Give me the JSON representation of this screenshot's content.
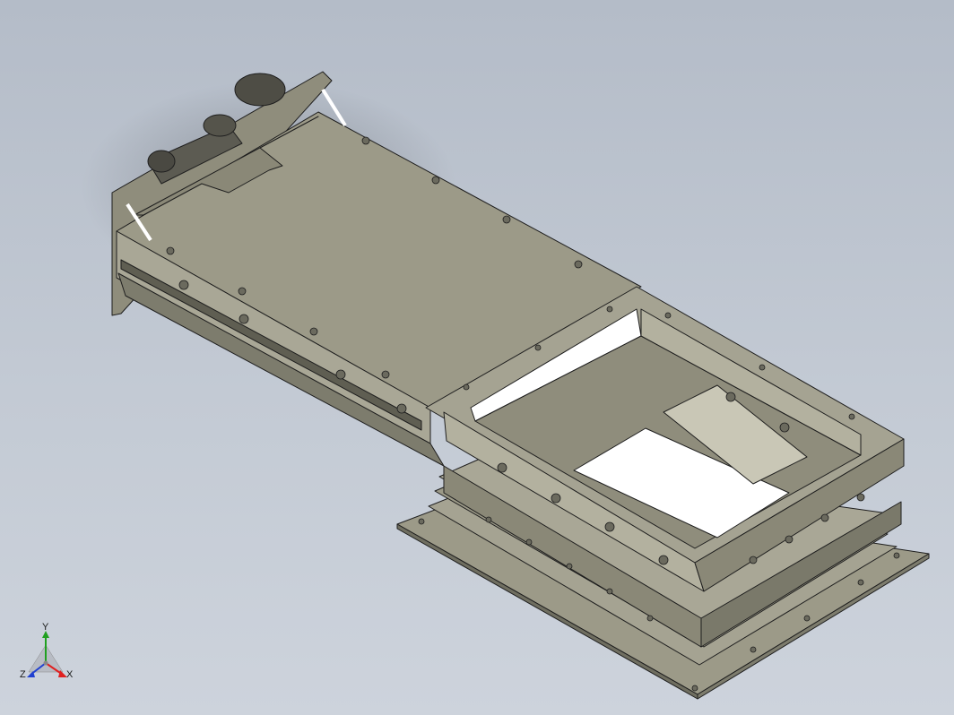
{
  "viewport": {
    "background_top": "#b4bcc8",
    "background_bottom": "#cdd3dc"
  },
  "model": {
    "body_color": "#9c9a88",
    "body_light": "#b3b19f",
    "body_dark": "#6f6e60",
    "edge_color": "#1e1e1e",
    "opening_color": "#ffffff"
  },
  "triad": {
    "x_label": "X",
    "y_label": "Y",
    "z_label": "Z",
    "x_color": "#e02020",
    "y_color": "#20a020",
    "z_color": "#2040d0"
  }
}
